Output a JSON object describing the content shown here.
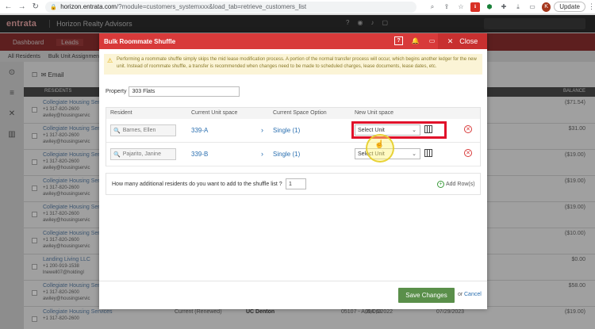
{
  "browser": {
    "url_host": "horizon.entrata.com",
    "url_path": "/?module=customers_systemxxx&load_tab=retrieve_customers_list",
    "profile_initial": "K",
    "update_label": "Update"
  },
  "app": {
    "logo": "entrata",
    "company": "Horizon Realty Advisors",
    "nav": [
      "Dashboard",
      "Leads"
    ],
    "subnav": [
      "All Residents",
      "Bulk Unit Assignments"
    ],
    "toolbar_label": "Email",
    "table_headers": {
      "residents": "RESIDENTS",
      "balance": "BALANCE"
    },
    "rows": [
      {
        "name": "Collegiate Housing Servic",
        "phone": "+1 317-820-2600",
        "email": "awiley@housingservic",
        "balance": "($71.54)"
      },
      {
        "name": "Collegiate Housing Servic",
        "phone": "+1 317-820-2600",
        "email": "awiley@housingservic",
        "balance": "$31.00"
      },
      {
        "name": "Collegiate Housing Servic",
        "phone": "+1 317-820-2600",
        "email": "awiley@housingservic",
        "balance": "($19.00)"
      },
      {
        "name": "Collegiate Housing Servic",
        "phone": "+1 317-820-2600",
        "email": "awiley@housingservic",
        "balance": "($19.00)"
      },
      {
        "name": "Collegiate Housing Servic",
        "phone": "+1 317-820-2600",
        "email": "awiley@housingservic",
        "balance": "($19.00)"
      },
      {
        "name": "Collegiate Housing Servic",
        "phone": "+1 317-820-2600",
        "email": "awiley@housingservic",
        "balance": "($10.00)"
      },
      {
        "name": "Landing Living LLC",
        "phone": "+1 200-919-1538",
        "email": "lnewell07@holdingl",
        "balance": "$0.00"
      },
      {
        "name": "Collegiate Housing Servic",
        "phone": "+1 317-820-2600",
        "email": "awiley@housingservic",
        "balance": "$58.00"
      },
      {
        "name": "Collegiate Housing Services",
        "phone": "+1 317-820-2600",
        "email": "",
        "balance": "($19.00)",
        "status": "Current (Renewed)",
        "prop": "UC Denton",
        "code": "05",
        "unit": "05107 - A,B,C,D",
        "date1": "09/06/2022",
        "date2": "07/29/2023"
      }
    ]
  },
  "modal": {
    "title": "Bulk Roommate Shuffle",
    "close_label": "Close",
    "warning": "Performing a roommate shuffle simply skips the mid lease modification process. A portion of the normal transfer process will occur, which begins another ledger for the new unit. Instead of roommate shuffle, a transfer is recommended when changes need to be made to scheduled charges, lease documents, lease dates, etc.",
    "property_label": "Property",
    "property_value": "303 Flats",
    "columns": {
      "resident": "Resident",
      "current_unit": "Current Unit space",
      "current_option": "Current Space Option",
      "new_unit": "New Unit space"
    },
    "rows": [
      {
        "resident": "Barnes, Ellen",
        "unit": "339-A",
        "option": "Single (1)",
        "new_unit": "Select Unit"
      },
      {
        "resident": "Pajarito, Janine",
        "unit": "339-B",
        "option": "Single (1)",
        "new_unit": "Select Unit"
      }
    ],
    "shuffle_question": "How many additional residents do you want to add to the shuffle list ?",
    "shuffle_count": "1",
    "add_rows_label": "Add Row(s)",
    "save_label": "Save Changes",
    "or_label": "or",
    "cancel_label": "Cancel"
  }
}
